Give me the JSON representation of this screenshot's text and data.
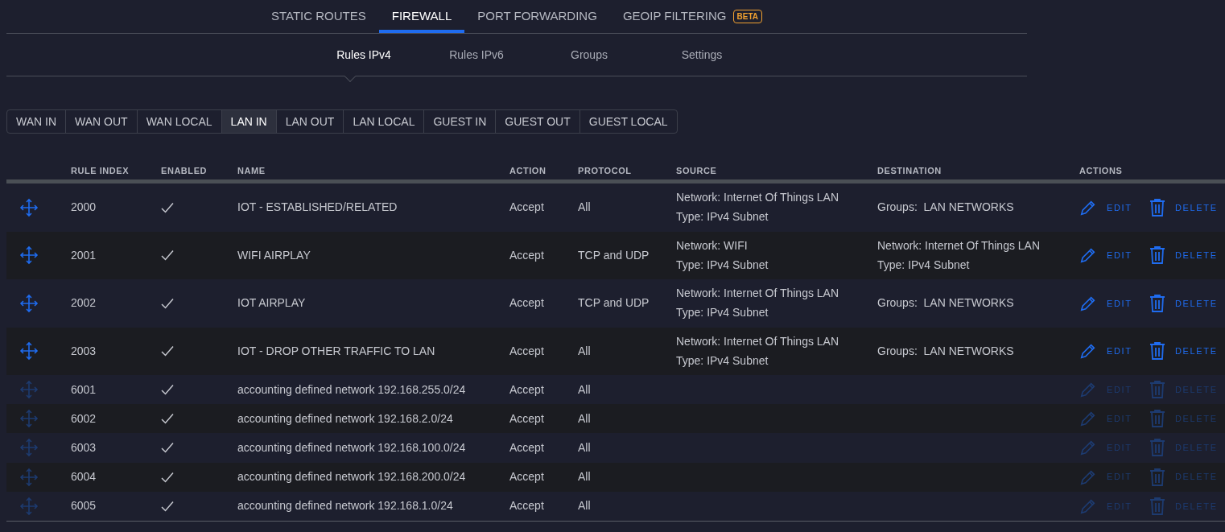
{
  "main_tabs": [
    {
      "label": "STATIC ROUTES",
      "selected": false
    },
    {
      "label": "FIREWALL",
      "selected": true
    },
    {
      "label": "PORT FORWARDING",
      "selected": false
    },
    {
      "label": "GEOIP FILTERING",
      "selected": false,
      "badge": "BETA"
    }
  ],
  "sub_tabs": [
    {
      "label": "Rules IPv4",
      "selected": true
    },
    {
      "label": "Rules IPv6",
      "selected": false
    },
    {
      "label": "Groups",
      "selected": false
    },
    {
      "label": "Settings",
      "selected": false
    }
  ],
  "filters": [
    {
      "label": "WAN IN",
      "selected": false
    },
    {
      "label": "WAN OUT",
      "selected": false
    },
    {
      "label": "WAN LOCAL",
      "selected": false
    },
    {
      "label": "LAN IN",
      "selected": true
    },
    {
      "label": "LAN OUT",
      "selected": false
    },
    {
      "label": "LAN LOCAL",
      "selected": false
    },
    {
      "label": "GUEST IN",
      "selected": false
    },
    {
      "label": "GUEST OUT",
      "selected": false
    },
    {
      "label": "GUEST LOCAL",
      "selected": false
    }
  ],
  "table": {
    "columns": [
      "RULE INDEX",
      "ENABLED",
      "NAME",
      "ACTION",
      "PROTOCOL",
      "SOURCE",
      "DESTINATION",
      "ACTIONS"
    ],
    "rows": [
      {
        "index": "2000",
        "enabled": true,
        "name": "IOT - ESTABLISHED/RELATED",
        "action": "Accept",
        "protocol": "All",
        "source": [
          "Network: Internet Of Things LAN",
          "Type: IPv4 Subnet"
        ],
        "destination": [
          "Groups:  LAN NETWORKS"
        ],
        "edit": "EDIT",
        "delete": "DELETE",
        "disabled": false
      },
      {
        "index": "2001",
        "enabled": true,
        "name": "WIFI AIRPLAY",
        "action": "Accept",
        "protocol": "TCP and UDP",
        "source": [
          "Network: WIFI",
          "Type: IPv4 Subnet"
        ],
        "destination": [
          "Network: Internet Of Things LAN",
          "Type: IPv4 Subnet"
        ],
        "edit": "EDIT",
        "delete": "DELETE",
        "disabled": false
      },
      {
        "index": "2002",
        "enabled": true,
        "name": "IOT AIRPLAY",
        "action": "Accept",
        "protocol": "TCP and UDP",
        "source": [
          "Network: Internet Of Things LAN",
          "Type: IPv4 Subnet"
        ],
        "destination": [
          "Groups:  LAN NETWORKS"
        ],
        "edit": "EDIT",
        "delete": "DELETE",
        "disabled": false
      },
      {
        "index": "2003",
        "enabled": true,
        "name": "IOT - DROP OTHER TRAFFIC TO LAN",
        "action": "Accept",
        "protocol": "All",
        "source": [
          "Network: Internet Of Things LAN",
          "Type: IPv4 Subnet"
        ],
        "destination": [
          "Groups:  LAN NETWORKS"
        ],
        "edit": "EDIT",
        "delete": "DELETE",
        "disabled": false
      },
      {
        "index": "6001",
        "enabled": true,
        "name": "accounting defined network 192.168.255.0/24",
        "action": "Accept",
        "protocol": "All",
        "source": [],
        "destination": [],
        "edit": "EDIT",
        "delete": "DELETE",
        "disabled": true
      },
      {
        "index": "6002",
        "enabled": true,
        "name": "accounting defined network 192.168.2.0/24",
        "action": "Accept",
        "protocol": "All",
        "source": [],
        "destination": [],
        "edit": "EDIT",
        "delete": "DELETE",
        "disabled": true
      },
      {
        "index": "6003",
        "enabled": true,
        "name": "accounting defined network 192.168.100.0/24",
        "action": "Accept",
        "protocol": "All",
        "source": [],
        "destination": [],
        "edit": "EDIT",
        "delete": "DELETE",
        "disabled": true
      },
      {
        "index": "6004",
        "enabled": true,
        "name": "accounting defined network 192.168.200.0/24",
        "action": "Accept",
        "protocol": "All",
        "source": [],
        "destination": [],
        "edit": "EDIT",
        "delete": "DELETE",
        "disabled": true
      },
      {
        "index": "6005",
        "enabled": true,
        "name": "accounting defined network 192.168.1.0/24",
        "action": "Accept",
        "protocol": "All",
        "source": [],
        "destination": [],
        "edit": "EDIT",
        "delete": "DELETE",
        "disabled": true
      }
    ]
  }
}
